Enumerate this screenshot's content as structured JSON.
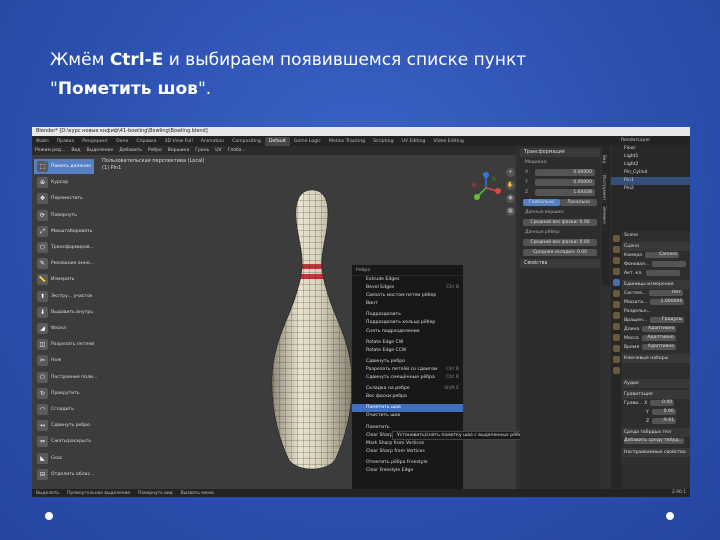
{
  "slide": {
    "heading_part1": "Жмём ",
    "heading_key": "Ctrl-E",
    "heading_part2": " и выбираем появившемся списке пункт",
    "heading_line2_open": "\"",
    "heading_line2_bold": "Пометить шов",
    "heading_line2_close": "\"."
  },
  "blender": {
    "title": "Blender* [D:\\курс новые кнфиф\\41-bowling\\Bowling\\Bowling.blend]",
    "workspaces": [
      "Файл",
      "Правка",
      "Рендеринг",
      "Окно",
      "Справка",
      "3D View Full",
      "Animation",
      "Compositing",
      "Default",
      "Game Logic",
      "Motion Tracking",
      "Scripting",
      "UV Editing",
      "Video Editing"
    ],
    "active_workspace": "Default",
    "scene_label": "Scene",
    "viewlayer_label": "RenderLayer",
    "viewport_header": [
      "Режим ред...",
      "Вид",
      "Выделение",
      "Добавить",
      "Ребро",
      "Вершина",
      "Грань",
      "UV",
      "Глоба..."
    ],
    "viewport_info_line1": "Пользовательская перспектива (Local)",
    "viewport_info_line2": "(1) Pin1",
    "tools": [
      "Пометь деление",
      "Курсор",
      "Переместить",
      "Повернуть",
      "Масштабировать",
      "Трансформиров...",
      "Рисование анно...",
      "Измерить",
      "Экстру... участок",
      "Выдавить внутрь",
      "Фаска",
      "Разрезать петлей",
      "Нож",
      "Построение поли...",
      "Прокрутить",
      "Сгладить",
      "Сдвинуть ребро",
      "Сжать/раскрыть",
      "Скос",
      "Отделить облас..."
    ],
    "menu": {
      "title": "Ребро",
      "items": [
        {
          "label": "Extrude Edges",
          "shortcut": ""
        },
        {
          "label": "Bevel Edges",
          "shortcut": "Ctrl B"
        },
        {
          "label": "Связать мостом петли рёбер",
          "shortcut": ""
        },
        {
          "label": "Винт",
          "shortcut": ""
        },
        {
          "label": "",
          "shortcut": ""
        },
        {
          "label": "Подразделить",
          "shortcut": ""
        },
        {
          "label": "Подразделить кольцо рёбер",
          "shortcut": ""
        },
        {
          "label": "Снять подразделение",
          "shortcut": ""
        },
        {
          "label": "",
          "shortcut": ""
        },
        {
          "label": "Rotate Edge CW",
          "shortcut": ""
        },
        {
          "label": "Rotate Edge CCW",
          "shortcut": ""
        },
        {
          "label": "",
          "shortcut": ""
        },
        {
          "label": "Сдвинуть ребро",
          "shortcut": ""
        },
        {
          "label": "Разрезать петлёй со сдвигом",
          "shortcut": "Ctrl R"
        },
        {
          "label": "Сдвинуть смещённые рёбра",
          "shortcut": "Ctrl R"
        },
        {
          "label": "",
          "shortcut": ""
        },
        {
          "label": "Складка на ребре",
          "shortcut": "Shift E"
        },
        {
          "label": "Вес фаски ребра",
          "shortcut": ""
        },
        {
          "label": "",
          "shortcut": ""
        },
        {
          "label": "Пометить шов",
          "shortcut": ""
        },
        {
          "label": "Очистить шов",
          "shortcut": ""
        },
        {
          "label": "",
          "shortcut": ""
        },
        {
          "label": "Пометить",
          "shortcut": ""
        },
        {
          "label": "Clear Sharp",
          "shortcut": ""
        },
        {
          "label": "Mark Sharp from Vertices",
          "shortcut": ""
        },
        {
          "label": "Clear Sharp from Vertices",
          "shortcut": ""
        },
        {
          "label": "",
          "shortcut": ""
        },
        {
          "label": "Отметить рёбра Freestyle",
          "shortcut": ""
        },
        {
          "label": "Clear Freestyle Edge",
          "shortcut": ""
        }
      ],
      "highlighted": "Пометить шов"
    },
    "tooltip": "Установить/снять пометку шва с выделенных рёбер.",
    "npanel": {
      "transform_header": "Трансформация",
      "median_label": "Медиана:",
      "x_label": "X",
      "x_value": "0.00000",
      "y_label": "Y",
      "y_value": "0.00000",
      "z_label": "Z",
      "z_value": "1.64438",
      "global_label": "Глобально",
      "local_label": "Локально",
      "vertex_data_label": "Данные вершин:",
      "mean_weight_label": "Средний вес фаски:",
      "mean_weight_value": "0.00",
      "edge_data_label": "Данные рёбер:",
      "edge_bevel_label": "Средний вес фаски:",
      "edge_bevel_value": "0.00",
      "edge_crease_label": "Средняя складка:",
      "edge_crease_value": "0.00",
      "properties_header": "Свойства",
      "tabs": [
        "Вид",
        "Инструмент",
        "Элемент"
      ]
    },
    "outliner": [
      "Floor",
      "Light1",
      "Light2",
      "Pin_Cylind",
      "Pin1",
      "Pin2"
    ],
    "outliner_selected": "Pin1",
    "props": {
      "scene_title": "Scene",
      "scene_header": "Сцена",
      "camera_label": "Камера",
      "camera_value": "Camera",
      "background_label": "Фоновая...",
      "active_label": "Акт. кл.",
      "units_header": "Единицы измерения",
      "system_label": "Систем...",
      "system_value": "Нет",
      "scale_label": "Масшта...",
      "scale_value": "1.000000",
      "separate_label": "Раздельн...",
      "rotation_label": "Вращен...",
      "rotation_value": "Градусы",
      "length_label": "Длина",
      "length_value": "Адаптивно",
      "mass_label": "Масса",
      "mass_value": "Адаптивно",
      "time_label": "Время",
      "time_value": "Адаптивно",
      "keying_header": "Ключевые наборы",
      "audio_header": "Аудио",
      "gravity_header": "Гравитация",
      "gravity_label": "Грави...",
      "gx_label": "X",
      "gx_value": "0.00",
      "gy_label": "Y",
      "gy_value": "0.00",
      "gz_label": "Z",
      "gz_value": "-9.81",
      "rigid_header": "Среда твёрдых тел",
      "rigid_add": "Добавить среду твёрд...",
      "custom_header": "Настраиваемые свойства"
    },
    "status": [
      "Выделить",
      "Прямоугольное выделение",
      "Повернуть вид",
      "Вызвать меню"
    ],
    "version": "2.90.1"
  }
}
